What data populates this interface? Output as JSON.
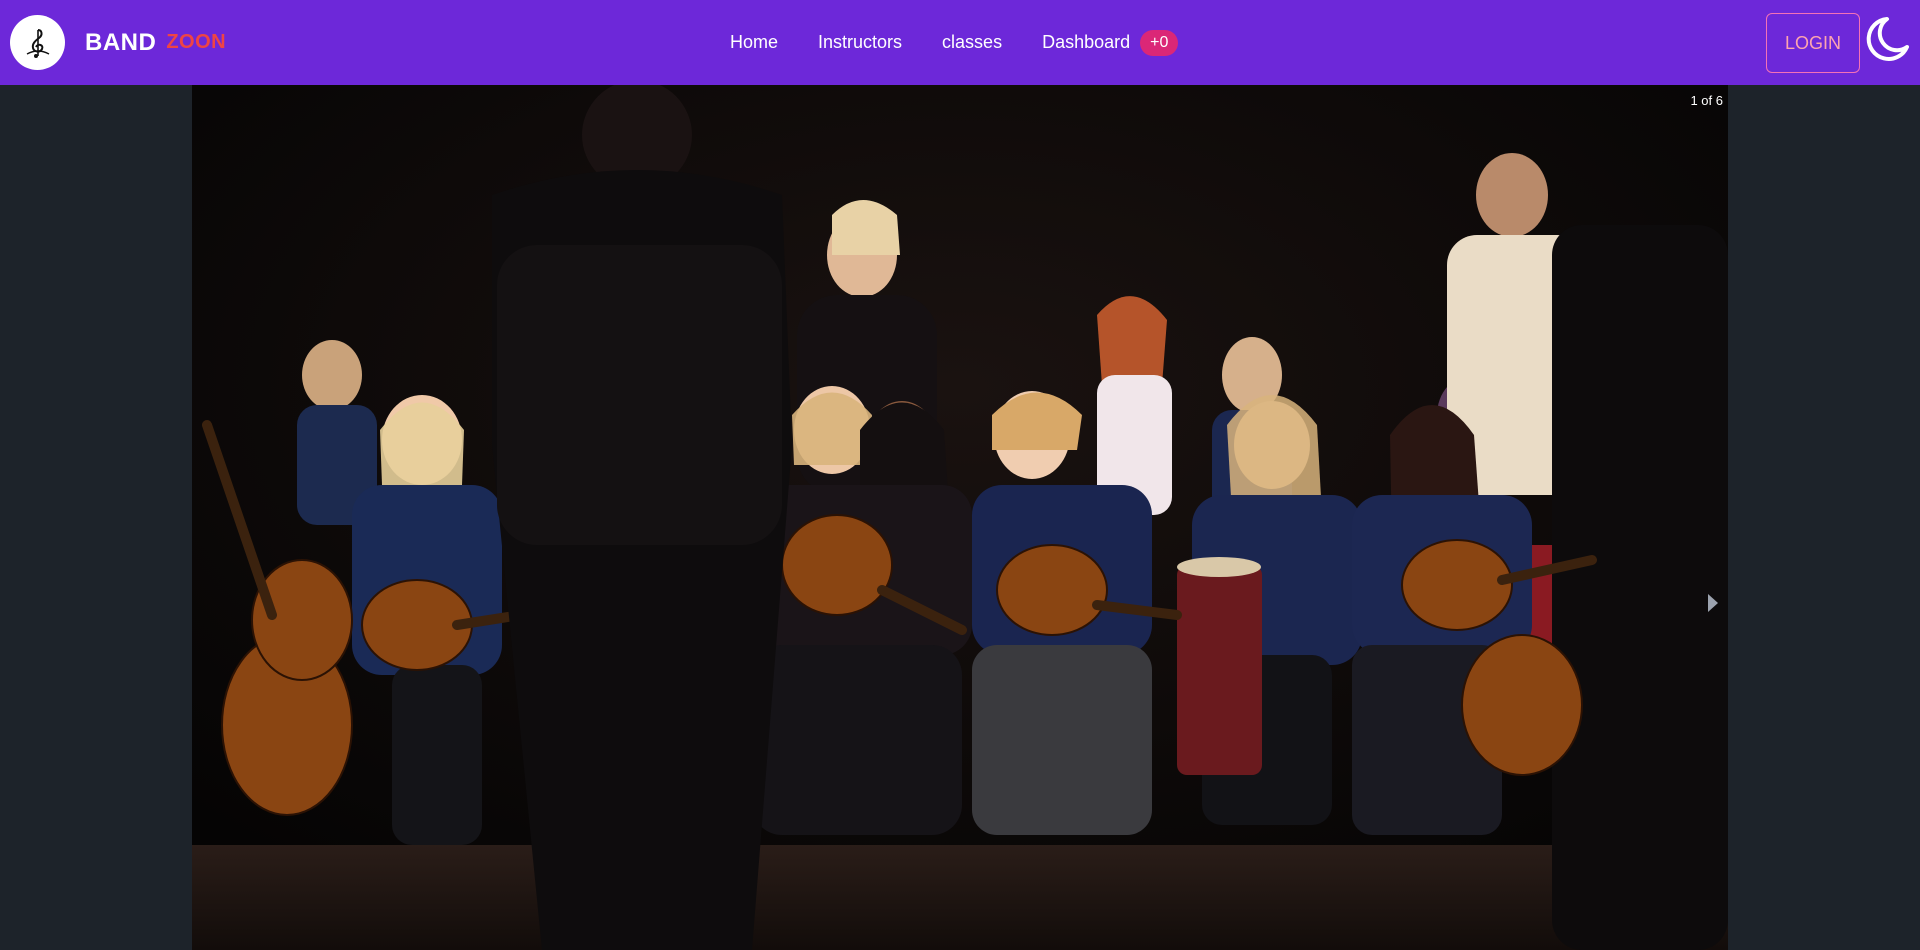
{
  "brand": {
    "name_primary": "BAND",
    "name_secondary": "ZOON"
  },
  "nav": {
    "items": [
      {
        "label": "Home"
      },
      {
        "label": "Instructors"
      },
      {
        "label": "classes"
      },
      {
        "label": "Dashboard"
      }
    ],
    "dashboard_badge": "+0"
  },
  "header": {
    "login_label": "LOGIN"
  },
  "carousel": {
    "counter": "1 of 6",
    "image_description_icon": "photo-children-guitar-ensemble"
  },
  "colors": {
    "navbar": "#6d28d9",
    "badge": "#db2777",
    "brand_accent": "#ef4444",
    "page_bg": "#1d232a"
  }
}
